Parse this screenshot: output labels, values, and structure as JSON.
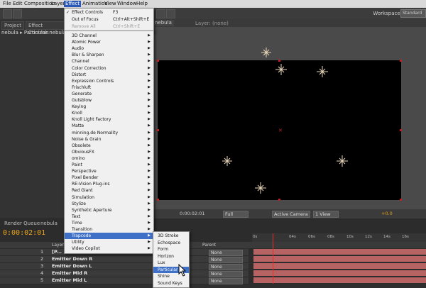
{
  "menubar": [
    "File",
    "Edit",
    "Composition",
    "Layer",
    "Effect",
    "Animation",
    "View",
    "Window",
    "Help"
  ],
  "toolbar": {
    "workspace_label": "Workspace:",
    "workspace_value": "Standard"
  },
  "left_panel": {
    "tab_project": "Project",
    "tab_effect_controls": "Effect Controls",
    "breadcrumb": "nebula ▸ Particular nebula"
  },
  "comp_panel": {
    "tab": "nebula",
    "layer_label": "Layer: (none)"
  },
  "effect_menu_top": [
    {
      "label": "Effect Controls",
      "shortcut": "F3",
      "checked": true
    },
    {
      "label": "Out of Focus",
      "shortcut": "Ctrl+Alt+Shift+E"
    },
    {
      "label": "Remove All",
      "shortcut": "Ctrl+Shift+E",
      "disabled": true
    }
  ],
  "effect_categories": [
    "3D Channel",
    "Atomic Power",
    "Audio",
    "Blur & Sharpen",
    "Channel",
    "Color Correction",
    "Distort",
    "Expression Controls",
    "Frischluft",
    "Generate",
    "Gutsblow",
    "Keying",
    "Knoll",
    "Knoll Light Factory",
    "Matte",
    "minning.de Normality",
    "Noise & Grain",
    "Obsolete",
    "ObviousFX",
    "omino",
    "Paint",
    "Perspective",
    "Pixel Bender",
    "RE:Vision Plug-ins",
    "Red Giant",
    "Simulation",
    "Stylize",
    "Synthetic Aperture",
    "Text",
    "Time",
    "Transition",
    "Trapcode",
    "Utility",
    "Video Copilot"
  ],
  "highlighted_category": "Trapcode",
  "trapcode_submenu": [
    "3D Stroke",
    "Echospace",
    "Form",
    "Horizon",
    "Lux",
    "Particular",
    "Shine",
    "Sound Keys"
  ],
  "highlighted_submenu": "Particular",
  "viewer_toolbar": {
    "timecode": "0:00:02:01",
    "resolution": "Full",
    "camera": "Active Camera",
    "views": "1 View",
    "exposure": "+0.0"
  },
  "timeline": {
    "tab_render_queue": "Render Queue",
    "tab_nebula": "nebula",
    "timecode": "0:00:02:01",
    "col_layer_name": "Layer Name",
    "col_parent": "Parent",
    "ruler": [
      "0s",
      "04s",
      "06s",
      "08s",
      "10s",
      "12s",
      "14s",
      "16s"
    ],
    "layers": [
      {
        "num": "1",
        "name": "[P...",
        "parent": "None"
      },
      {
        "num": "2",
        "name": "Emitter Down R",
        "parent": "None"
      },
      {
        "num": "3",
        "name": "Emitter Down L",
        "parent": "None"
      },
      {
        "num": "4",
        "name": "Emitter Mid R",
        "parent": "None"
      },
      {
        "num": "5",
        "name": "Emitter Mid L",
        "parent": "None"
      }
    ]
  },
  "colors": {
    "menu_highlight": "#3e70c8",
    "timecode": "#e8a21c",
    "track": "#b86363",
    "playhead": "#e03030"
  }
}
